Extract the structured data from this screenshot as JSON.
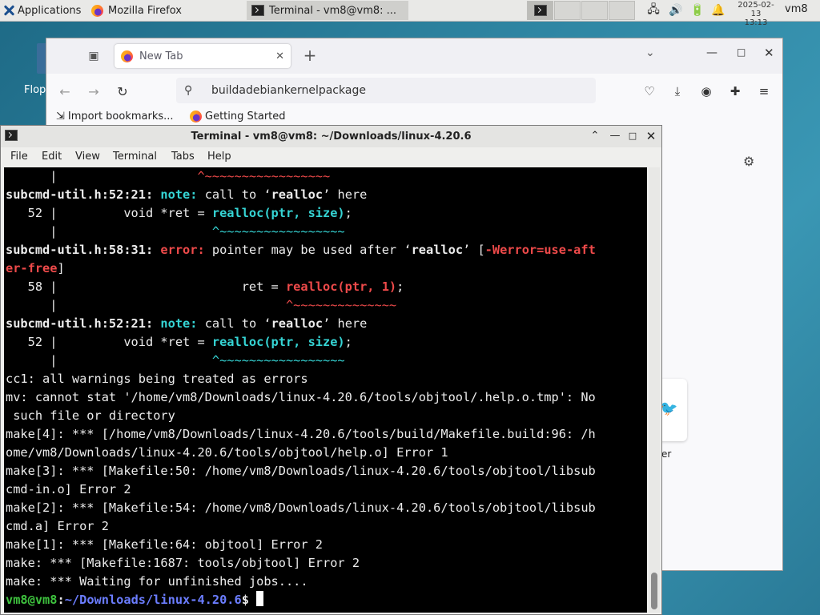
{
  "panel": {
    "apps_label": "Applications",
    "tasks": [
      {
        "label": "Mozilla Firefox"
      },
      {
        "label": "Terminal - vm8@vm8: ..."
      }
    ],
    "clock_date": "2025-02-13",
    "clock_time": "13:13",
    "user": "vm8",
    "icons": [
      "xfce-icon",
      "firefox-icon",
      "terminal-icon",
      "network-icon",
      "volume-icon",
      "battery-icon",
      "notification-bell-icon"
    ]
  },
  "desktop": {
    "icon_label": "Flop"
  },
  "firefox": {
    "tab_label": "New Tab",
    "url": "buildadebiankernelpackage",
    "bookmarks": [
      "Import bookmarks...",
      "Getting Started"
    ],
    "shortcut_label": "er"
  },
  "terminal": {
    "title": "Terminal - vm8@vm8: ~/Downloads/linux-4.20.6",
    "menu": [
      "File",
      "Edit",
      "View",
      "Terminal",
      "Tabs",
      "Help"
    ],
    "lines": [
      [
        {
          "t": "      |                   "
        },
        {
          "t": "^~~~~~~~~~~~~~~~~~",
          "c": "caret"
        }
      ],
      [
        {
          "t": "subcmd-util.h:52:21:",
          "c": "b"
        },
        {
          "t": " "
        },
        {
          "t": "note:",
          "c": "b cy"
        },
        {
          "t": " call to ‘"
        },
        {
          "t": "realloc",
          "c": "b"
        },
        {
          "t": "’ here"
        }
      ],
      [
        {
          "t": "   52 |         void *ret = "
        },
        {
          "t": "realloc(ptr, size)",
          "c": "b cy"
        },
        {
          "t": ";"
        }
      ],
      [
        {
          "t": "      |                     "
        },
        {
          "t": "^~~~~~~~~~~~~~~~~~",
          "c": "cy"
        }
      ],
      [
        {
          "t": "subcmd-util.h:58:31:",
          "c": "b"
        },
        {
          "t": " "
        },
        {
          "t": "error:",
          "c": "b red"
        },
        {
          "t": " pointer may be used after ‘"
        },
        {
          "t": "realloc",
          "c": "b"
        },
        {
          "t": "’ ["
        },
        {
          "t": "-Werror=use-aft",
          "c": "b red"
        }
      ],
      [
        {
          "t": "er-free",
          "c": "b red"
        },
        {
          "t": "]"
        }
      ],
      [
        {
          "t": "   58 |                         ret = "
        },
        {
          "t": "realloc(ptr, 1)",
          "c": "b red"
        },
        {
          "t": ";"
        }
      ],
      [
        {
          "t": "      |                               "
        },
        {
          "t": "^~~~~~~~~~~~~~~",
          "c": "caret"
        }
      ],
      [
        {
          "t": "subcmd-util.h:52:21:",
          "c": "b"
        },
        {
          "t": " "
        },
        {
          "t": "note:",
          "c": "b cy"
        },
        {
          "t": " call to ‘"
        },
        {
          "t": "realloc",
          "c": "b"
        },
        {
          "t": "’ here"
        }
      ],
      [
        {
          "t": "   52 |         void *ret = "
        },
        {
          "t": "realloc(ptr, size)",
          "c": "b cy"
        },
        {
          "t": ";"
        }
      ],
      [
        {
          "t": "      |                     "
        },
        {
          "t": "^~~~~~~~~~~~~~~~~~",
          "c": "cy"
        }
      ],
      [
        {
          "t": "cc1: all warnings being treated as errors"
        }
      ],
      [
        {
          "t": "mv: cannot stat '/home/vm8/Downloads/linux-4.20.6/tools/objtool/.help.o.tmp': No"
        }
      ],
      [
        {
          "t": " such file or directory"
        }
      ],
      [
        {
          "t": "make[4]: *** [/home/vm8/Downloads/linux-4.20.6/tools/build/Makefile.build:96: /h"
        }
      ],
      [
        {
          "t": "ome/vm8/Downloads/linux-4.20.6/tools/objtool/help.o] Error 1"
        }
      ],
      [
        {
          "t": "make[3]: *** [Makefile:50: /home/vm8/Downloads/linux-4.20.6/tools/objtool/libsub"
        }
      ],
      [
        {
          "t": "cmd-in.o] Error 2"
        }
      ],
      [
        {
          "t": "make[2]: *** [Makefile:54: /home/vm8/Downloads/linux-4.20.6/tools/objtool/libsub"
        }
      ],
      [
        {
          "t": "cmd.a] Error 2"
        }
      ],
      [
        {
          "t": "make[1]: *** [Makefile:64: objtool] Error 2"
        }
      ],
      [
        {
          "t": "make: *** [Makefile:1687: tools/objtool] Error 2"
        }
      ],
      [
        {
          "t": "make: *** Waiting for unfinished jobs...."
        }
      ],
      [
        {
          "t": "vm8@vm8",
          "c": "b grn"
        },
        {
          "t": ":",
          "c": "b"
        },
        {
          "t": "~/Downloads/linux-4.20.6",
          "c": "b blu"
        },
        {
          "t": "$ ",
          "c": "b"
        },
        {
          "t": "",
          "c": "cursor"
        }
      ]
    ]
  },
  "colors": {
    "error": "#ee4a4a",
    "note": "#35d4d4",
    "prompt_user": "#3ec23e",
    "prompt_path": "#6b7dff"
  }
}
